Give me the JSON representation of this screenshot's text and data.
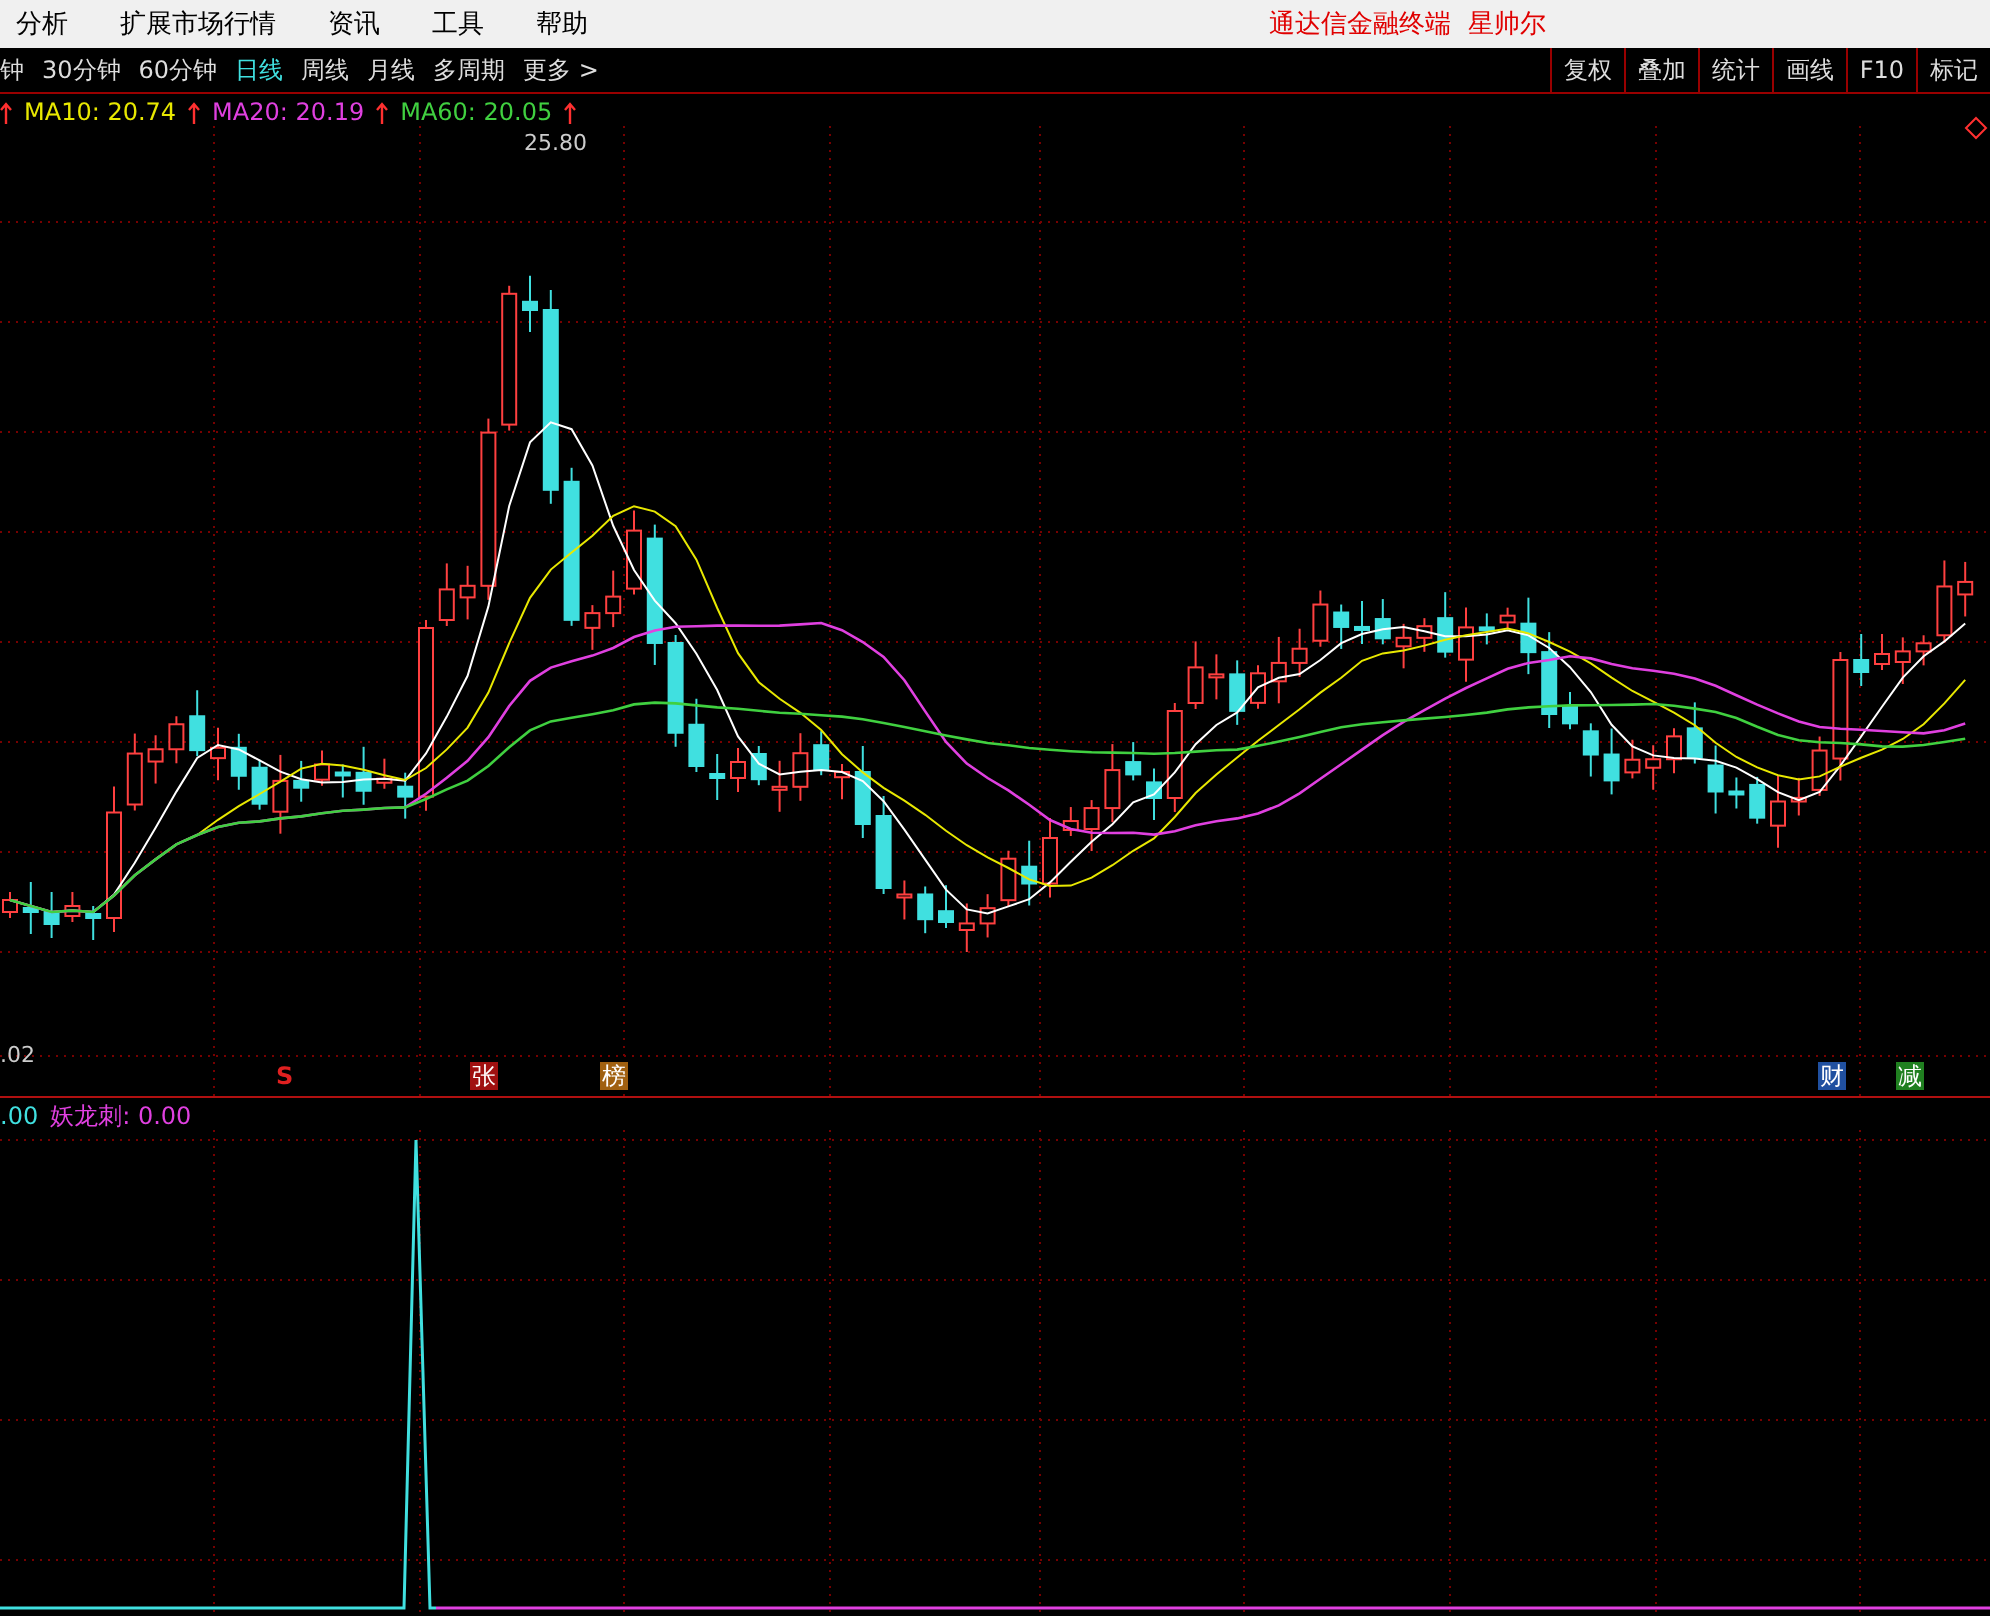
{
  "menu": {
    "items": [
      "分析",
      "扩展市场行情",
      "资讯",
      "工具",
      "帮助"
    ],
    "title": "通达信金融终端  星帅尔"
  },
  "periods": [
    {
      "label": "钟",
      "selected": false
    },
    {
      "label": "30分钟",
      "selected": false
    },
    {
      "label": "60分钟",
      "selected": false
    },
    {
      "label": "日线",
      "selected": true
    },
    {
      "label": "周线",
      "selected": false
    },
    {
      "label": "月线",
      "selected": false
    },
    {
      "label": "多周期",
      "selected": false
    },
    {
      "label": "更多 >",
      "selected": false
    }
  ],
  "tools": [
    "复权",
    "叠加",
    "统计",
    "画线",
    "F10",
    "标记"
  ],
  "legend": [
    {
      "label": "MA10: 20.74",
      "color": "#e8e800"
    },
    {
      "label": "MA20: 20.19",
      "color": "#e040e0"
    },
    {
      "label": "MA60: 20.05",
      "color": "#40d040"
    }
  ],
  "high_label": "25.80",
  "axis_label": ".02",
  "markers": [
    {
      "label": "S",
      "color": "#e02020"
    },
    {
      "label": "张",
      "color": "#a01010"
    },
    {
      "label": "榜",
      "color": "#a06010"
    },
    {
      "label": "财",
      "color": "#2050a0"
    },
    {
      "label": "减",
      "color": "#208020"
    }
  ],
  "indicator": {
    "value": ".00",
    "name": "妖龙刺: 0.00"
  }
}
